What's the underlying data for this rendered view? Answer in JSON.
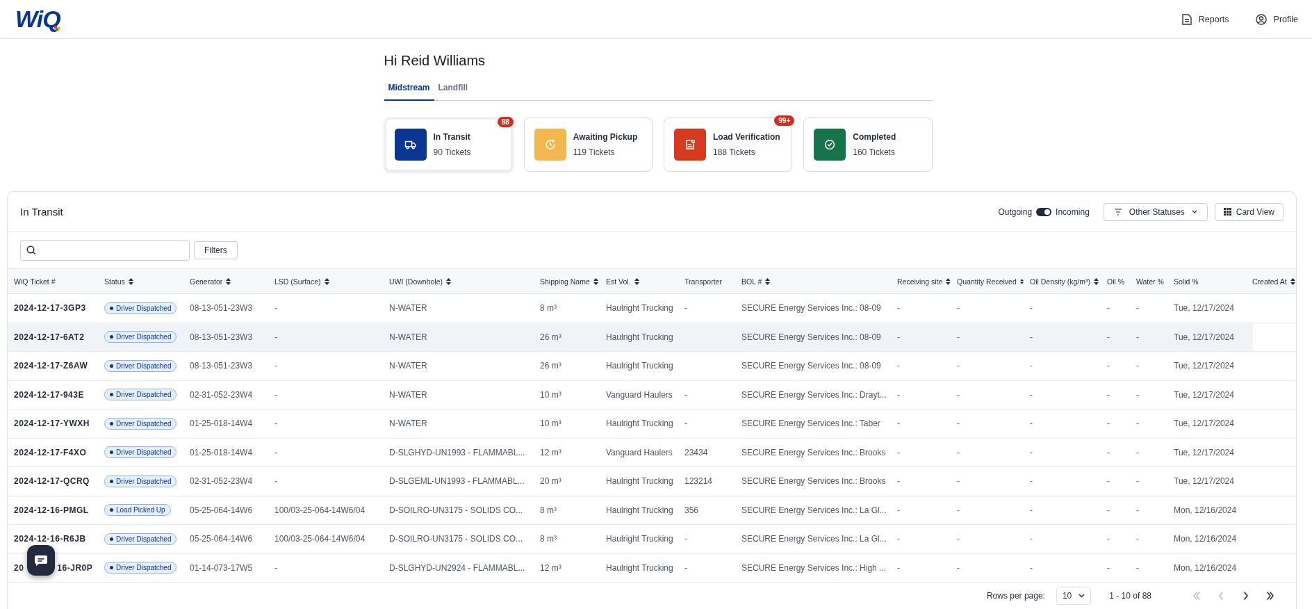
{
  "header": {
    "logo": "WiQ",
    "nav": [
      {
        "kind": "reports",
        "label": "Reports"
      },
      {
        "kind": "profile",
        "label": "Profile"
      }
    ]
  },
  "greeting": "Hi Reid Williams",
  "tabs": [
    {
      "label": "Midstream",
      "selected": true
    },
    {
      "label": "Landfill",
      "selected": false
    }
  ],
  "status_cards": [
    {
      "kind": "truck",
      "color": "#0a3592",
      "title": "In Transit",
      "count": "90 Tickets",
      "badge": "88",
      "selected": true
    },
    {
      "kind": "clock",
      "color": "#f2b84f",
      "title": "Awaiting Pickup",
      "count": "119 Tickets",
      "selected": false
    },
    {
      "kind": "document",
      "color": "#d63b20",
      "title": "Load Verification",
      "count": "188 Tickets",
      "badge": "99+",
      "selected": false
    },
    {
      "kind": "check",
      "color": "#17734a",
      "title": "Completed",
      "count": "160 Tickets",
      "selected": false
    }
  ],
  "panel": {
    "title": "In Transit",
    "toggle": {
      "left": "Outgoing",
      "right": "Incoming",
      "on": true
    },
    "status_filter": "Other Statuses",
    "view_button": "Card View",
    "filters_button": "Filters"
  },
  "table": {
    "columns": [
      {
        "label": "WiQ Ticket #",
        "sortable": false
      },
      {
        "label": "Status",
        "sortable": true
      },
      {
        "label": "Generator",
        "sortable": true
      },
      {
        "label": "LSD (Surface)",
        "sortable": true
      },
      {
        "label": "UWI (Downhole)",
        "sortable": true
      },
      {
        "label": "Shipping Name",
        "sortable": true
      },
      {
        "label": "Est Vol.",
        "sortable": true
      },
      {
        "label": "Transporter",
        "sortable": false
      },
      {
        "label": "BOL #",
        "sortable": true
      },
      {
        "label": "Receiving site",
        "sortable": true
      },
      {
        "label": "Quantity Received",
        "sortable": true
      },
      {
        "label": "Oil Density (kg/m³)",
        "sortable": true
      },
      {
        "label": "Oil %",
        "sortable": false
      },
      {
        "label": "Water %",
        "sortable": false
      },
      {
        "label": "Solid %",
        "sortable": false
      },
      {
        "label": "Created At",
        "sortable": true
      }
    ],
    "rows": [
      {
        "hovered": false,
        "cells": [
          "2024-12-17-3GP3",
          "Driver Dispatched",
          "08-13-051-23W3",
          "-",
          "N-WATER",
          "8 m³",
          "Haulright Trucking",
          "-",
          "SECURE Energy Services Inc.: 08-09",
          "-",
          "-",
          "-",
          "-",
          "-",
          "Tue, 12/17/2024",
          ""
        ]
      },
      {
        "hovered": true,
        "cells": [
          "2024-12-17-6AT2",
          "Driver Dispatched",
          "08-13-051-23W3",
          "-",
          "N-WATER",
          "26 m³",
          "Haulright Trucking",
          "",
          "SECURE Energy Services Inc.: 08-09",
          "-",
          "-",
          "-",
          "-",
          "-",
          "Tue, 12/17/2024",
          ""
        ]
      },
      {
        "hovered": false,
        "cells": [
          "2024-12-17-Z6AW",
          "Driver Dispatched",
          "08-13-051-23W3",
          "-",
          "N-WATER",
          "26 m³",
          "Haulright Trucking",
          "",
          "SECURE Energy Services Inc.: 08-09",
          "-",
          "-",
          "-",
          "-",
          "-",
          "Tue, 12/17/2024",
          ""
        ]
      },
      {
        "hovered": false,
        "cells": [
          "2024-12-17-943E",
          "Driver Dispatched",
          "02-31-052-23W4",
          "-",
          "N-WATER",
          "10 m³",
          "Vanguard Haulers",
          "-",
          "SECURE Energy Services Inc.: Drayt...",
          "-",
          "-",
          "-",
          "-",
          "-",
          "Tue, 12/17/2024",
          ""
        ]
      },
      {
        "hovered": false,
        "cells": [
          "2024-12-17-YWXH",
          "Driver Dispatched",
          "01-25-018-14W4",
          "-",
          "N-WATER",
          "10 m³",
          "Haulright Trucking",
          "-",
          "SECURE Energy Services Inc.: Taber",
          "-",
          "-",
          "-",
          "-",
          "-",
          "Tue, 12/17/2024",
          ""
        ]
      },
      {
        "hovered": false,
        "cells": [
          "2024-12-17-F4XO",
          "Driver Dispatched",
          "01-25-018-14W4",
          "-",
          "D-SLGHYD-UN1993 - FLAMMABL...",
          "12 m³",
          "Vanguard Haulers",
          "23434",
          "SECURE Energy Services Inc.: Brooks",
          "-",
          "-",
          "-",
          "-",
          "-",
          "Tue, 12/17/2024",
          ""
        ]
      },
      {
        "hovered": false,
        "cells": [
          "2024-12-17-QCRQ",
          "Driver Dispatched",
          "02-31-052-23W4",
          "-",
          "D-SLGEML-UN1993 - FLAMMABL...",
          "20 m³",
          "Haulright Trucking",
          "123214",
          "SECURE Energy Services Inc.: Brooks",
          "-",
          "-",
          "-",
          "-",
          "-",
          "Tue, 12/17/2024",
          ""
        ]
      },
      {
        "hovered": false,
        "cells": [
          "2024-12-16-PMGL",
          "Load Picked Up",
          "05-25-064-14W6",
          "100/03-25-064-14W6/04",
          "D-SOILRO-UN3175 - SOLIDS CO...",
          "8 m³",
          "Haulright Trucking",
          "356",
          "SECURE Energy Services Inc.: La Gl...",
          "-",
          "-",
          "-",
          "-",
          "-",
          "Mon, 12/16/2024",
          ""
        ]
      },
      {
        "hovered": false,
        "cells": [
          "2024-12-16-R6JB",
          "Driver Dispatched",
          "05-25-064-14W6",
          "100/03-25-064-14W6/04",
          "D-SOILRO-UN3175 - SOLIDS CO...",
          "8 m³",
          "Haulright Trucking",
          "-",
          "SECURE Energy Services Inc.: La Gl...",
          "-",
          "-",
          "-",
          "-",
          "-",
          "Mon, 12/16/2024",
          ""
        ]
      },
      {
        "hovered": false,
        "cells": [
          [
            "20",
            "16-JR0P"
          ],
          "Driver Dispatched",
          "01-14-073-17W5",
          "-",
          "D-SLGHYD-UN2924 - FLAMMABL...",
          "12 m³",
          "Haulright Trucking",
          "-",
          "SECURE Energy Services Inc.: High ...",
          "-",
          "-",
          "-",
          "-",
          "-",
          "Mon, 12/16/2024",
          ""
        ]
      }
    ]
  },
  "pagination": {
    "rows_label": "Rows per page:",
    "rows_value": "10",
    "range": "1 - 10 of 88",
    "first_disabled": true,
    "prev_disabled": true,
    "next_disabled": false,
    "last_disabled": false
  }
}
